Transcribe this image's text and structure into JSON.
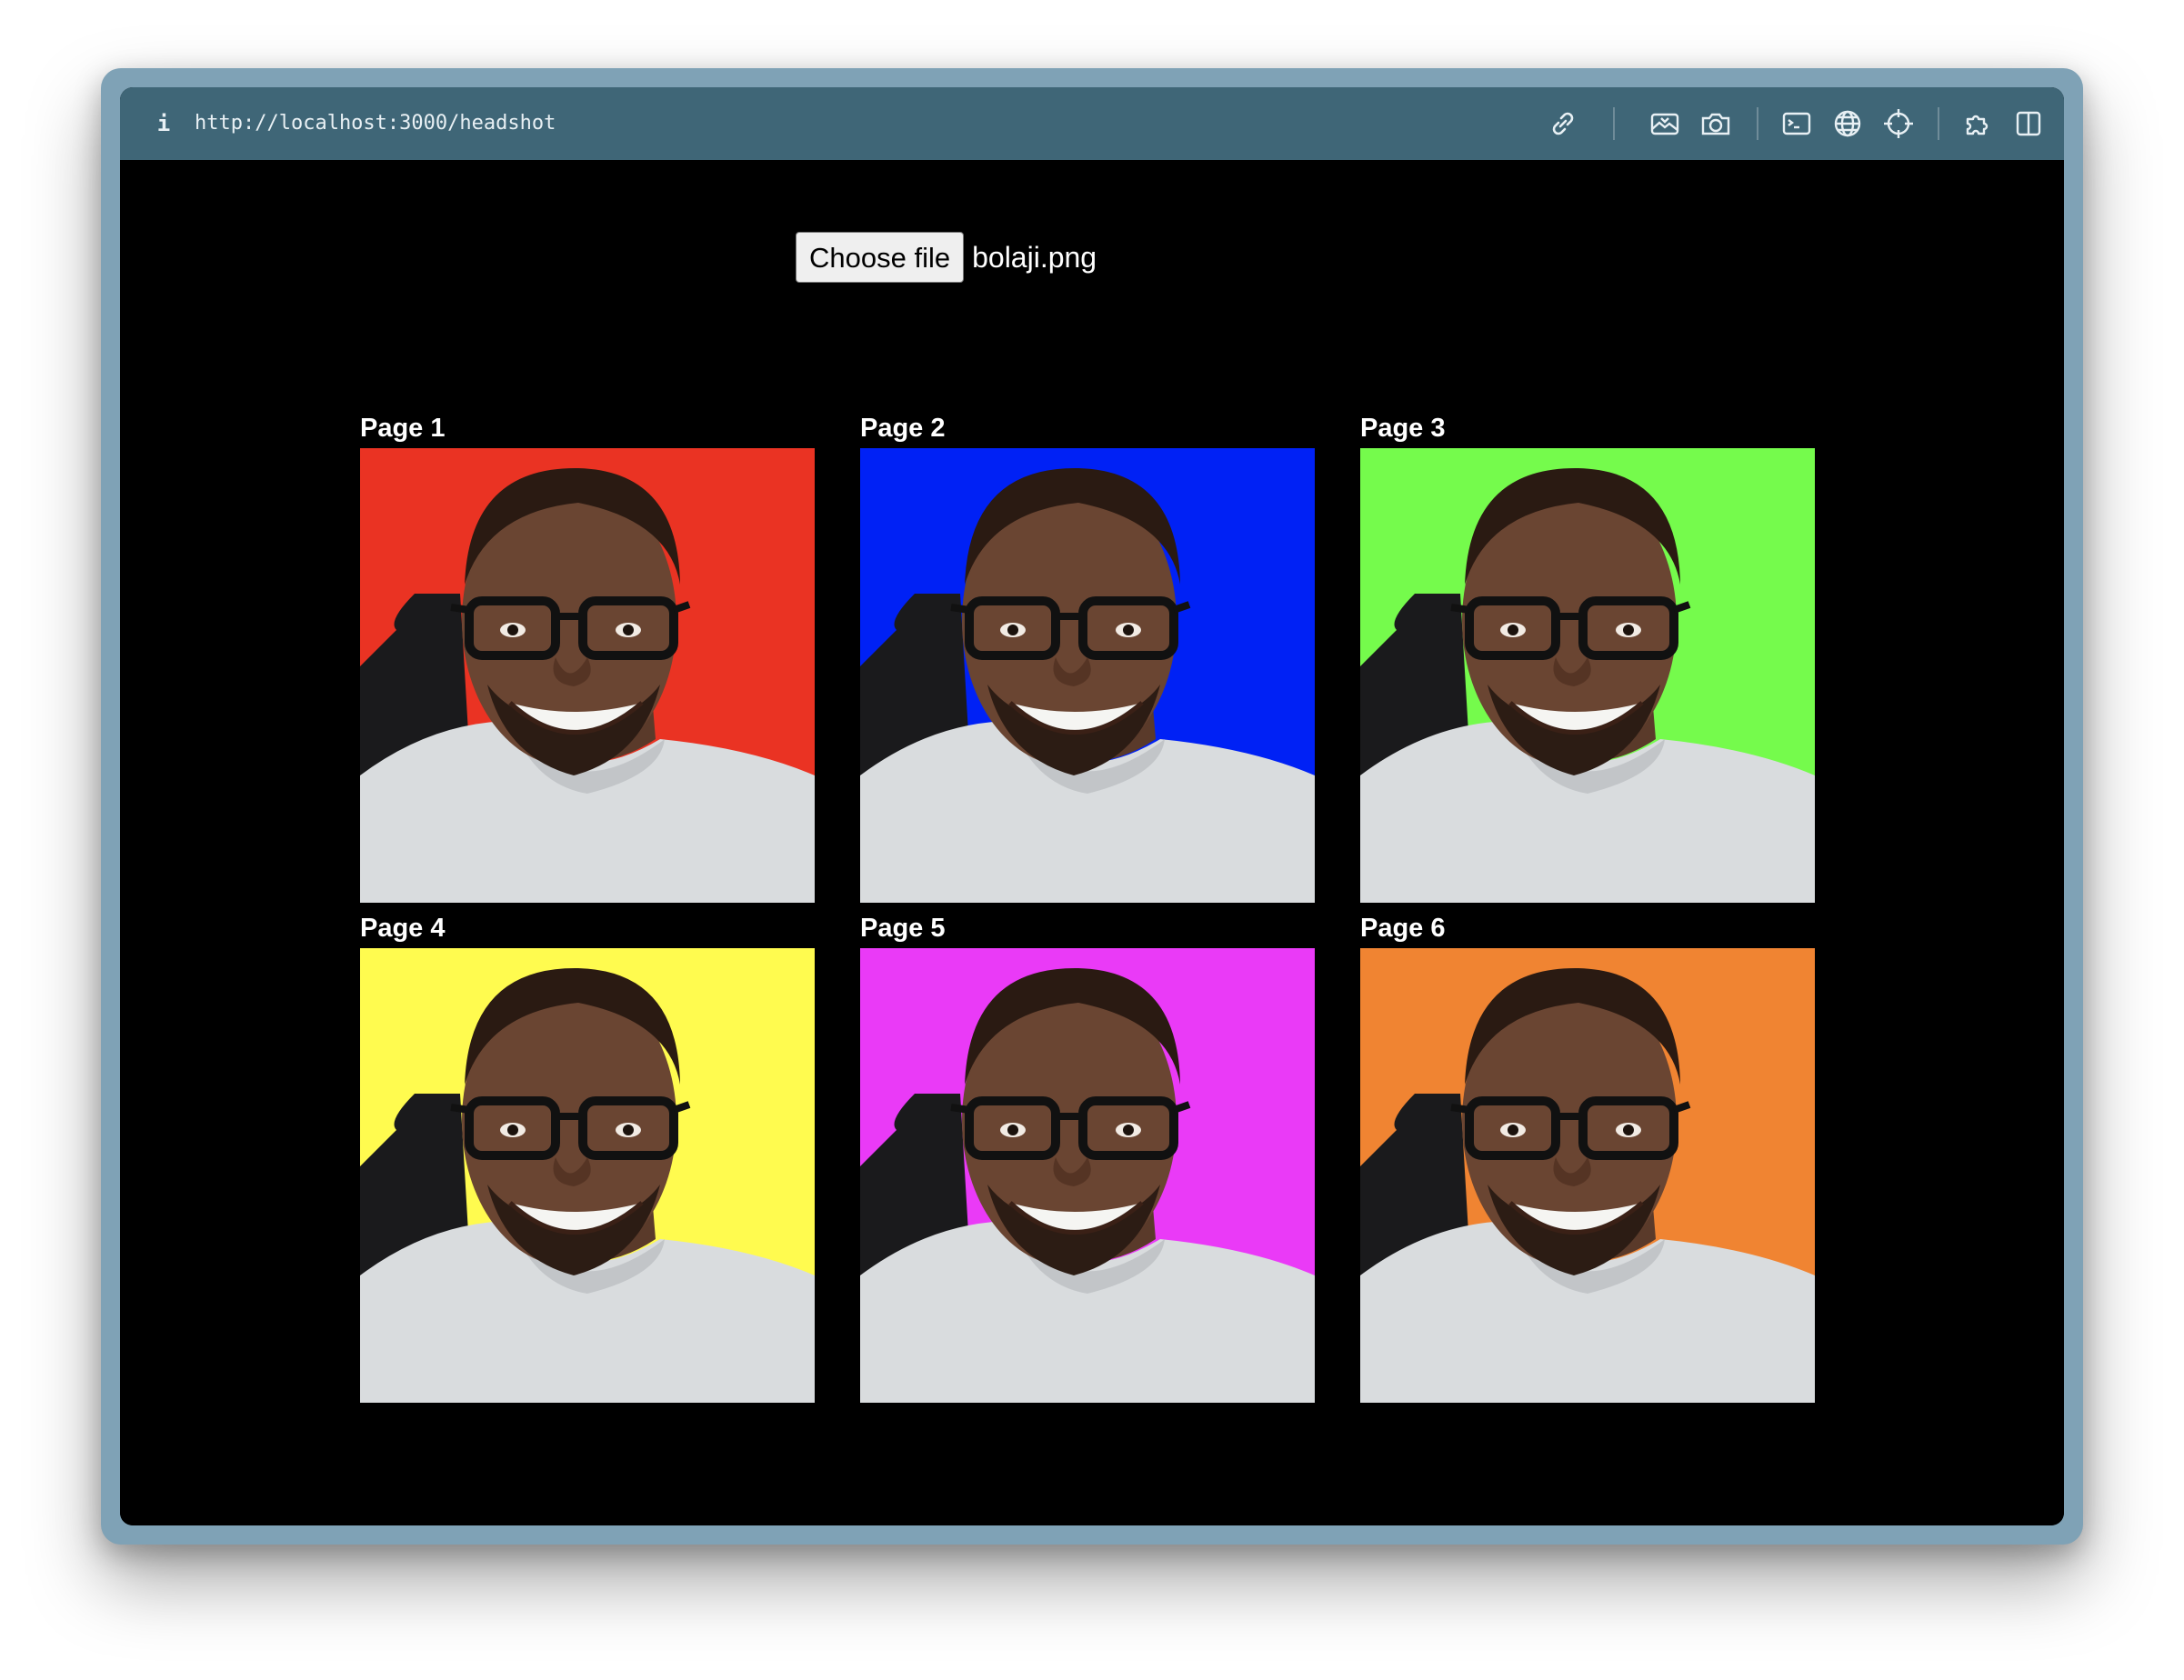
{
  "browser": {
    "url": "http://localhost:3000/headshot",
    "info_glyph": "i",
    "toolbar_icons": [
      "link-icon",
      "screenshot-icon",
      "camera-icon",
      "terminal-icon",
      "globe-icon",
      "crosshair-icon",
      "extension-icon",
      "split-view-icon"
    ]
  },
  "upload": {
    "button_label": "Choose file",
    "file_name": "bolaji.png"
  },
  "cards": [
    {
      "label": "Page 1",
      "bg": "#ea3323"
    },
    {
      "label": "Page 2",
      "bg": "#0021f5"
    },
    {
      "label": "Page 3",
      "bg": "#75fb4c"
    },
    {
      "label": "Page 4",
      "bg": "#fffb4f"
    },
    {
      "label": "Page 5",
      "bg": "#ea3af7"
    },
    {
      "label": "Page 6",
      "bg": "#f08432"
    }
  ],
  "colors": {
    "toolbar": "#3f6677",
    "frame": "#7fa2b6",
    "page_bg": "#000000"
  }
}
